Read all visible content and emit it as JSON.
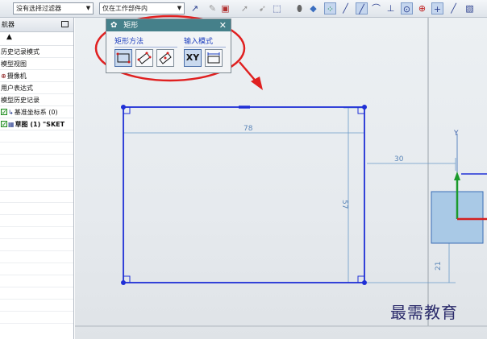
{
  "toolbar": {
    "selection_filter": "没有选择过滤器",
    "scope_filter": "仅在工作部件内"
  },
  "navigator": {
    "title": "航器",
    "items": [
      {
        "label": "历史记录模式"
      },
      {
        "label": "模型视图"
      },
      {
        "label": "摄像机"
      },
      {
        "label": "用户表达式"
      },
      {
        "label": "模型历史记录"
      },
      {
        "label": "基准坐标系 (0)"
      },
      {
        "label": "草图 (1) \"SKET"
      }
    ]
  },
  "dialog": {
    "title": "矩形",
    "method_label": "矩形方法",
    "input_mode_label": "输入模式",
    "xy_label": "XY"
  },
  "dimensions": {
    "width": "78",
    "height": "57",
    "offset_x": "30",
    "offset_y": "21"
  },
  "colors": {
    "sketch": "#1f2fd6",
    "dimension": "#6a9ac8",
    "annotation": "#e02020",
    "dialog_title": "#45808a"
  },
  "watermark": "最需教育"
}
